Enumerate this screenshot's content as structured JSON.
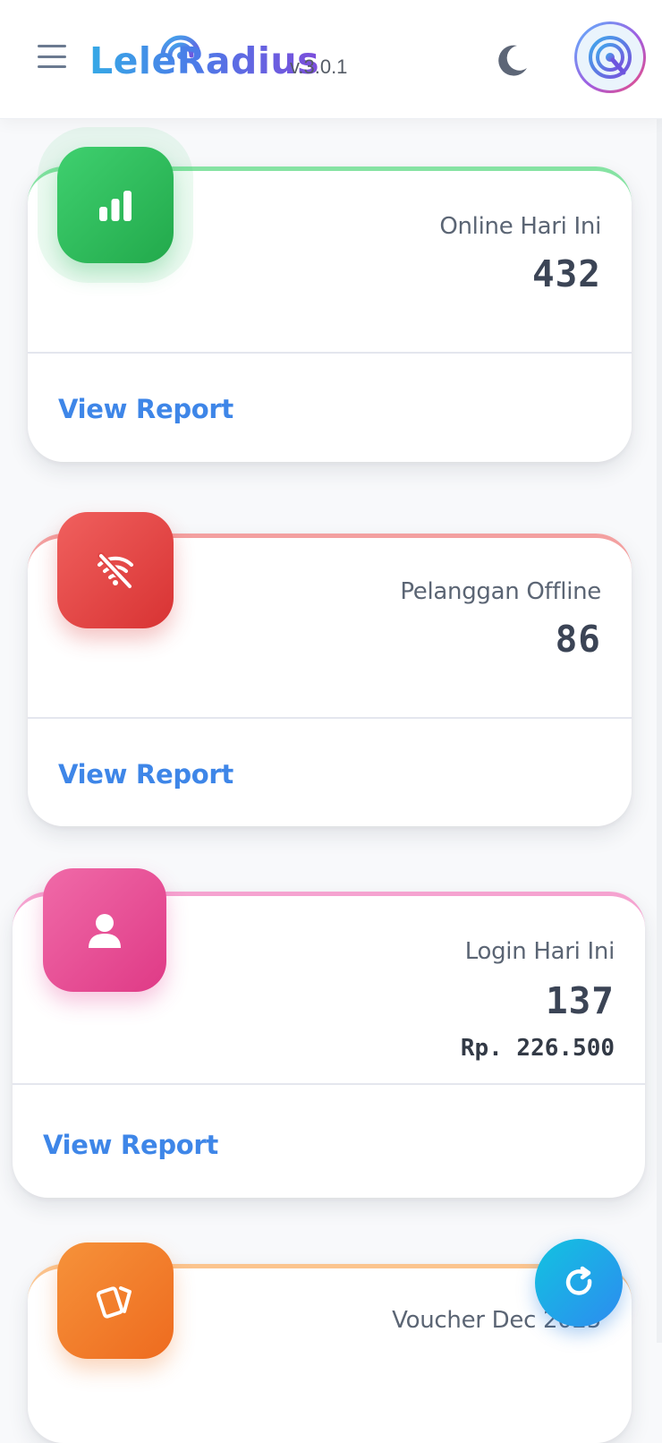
{
  "app": {
    "logo_text": "LeleRadius",
    "version": "v.3.0.1"
  },
  "colors": {
    "green": "#2fbf5b",
    "red": "#e53e3e",
    "pink": "#e94b91",
    "orange": "#f27b22",
    "link": "#3e86e8",
    "fab": "#1aa9e6"
  },
  "header": {
    "menu_icon": "menu-icon",
    "theme_icon": "moon-icon",
    "avatar_icon": "radius-logo-icon"
  },
  "cards": [
    {
      "icon": "signal-bars-icon",
      "label": "Online Hari Ini",
      "value": "432",
      "link": "View Report",
      "color": "green"
    },
    {
      "icon": "wifi-off-icon",
      "label": "Pelanggan Offline",
      "value": "86",
      "link": "View Report",
      "color": "red"
    },
    {
      "icon": "user-icon",
      "label": "Login Hari Ini",
      "value": "137",
      "sub_value": "Rp. 226.500",
      "link": "View Report",
      "color": "pink"
    },
    {
      "icon": "voucher-cards-icon",
      "label": "Voucher Dec 2025",
      "color": "orange"
    }
  ],
  "fab": {
    "icon": "refresh-icon"
  }
}
